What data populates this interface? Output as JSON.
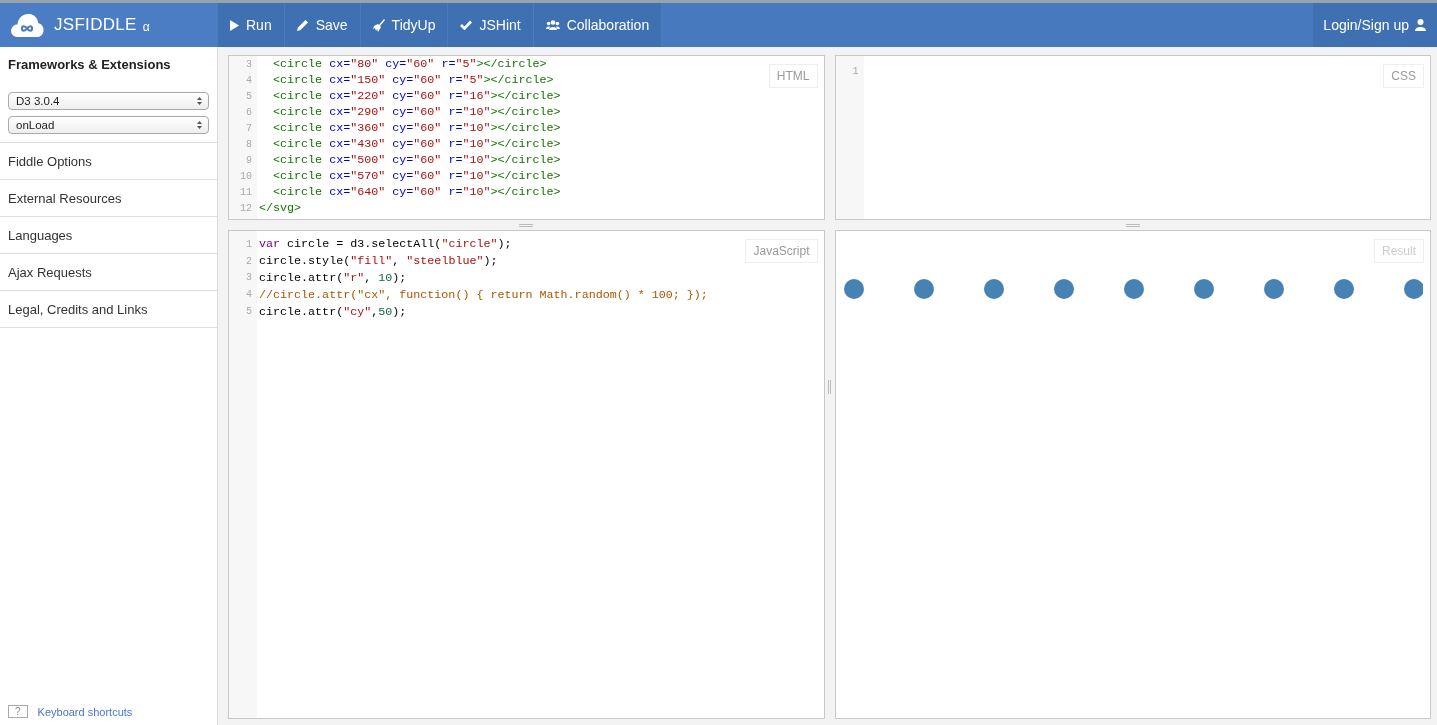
{
  "header": {
    "logo": "JSFIDDLE",
    "logo_suffix": "α",
    "actions": [
      {
        "label": "Run",
        "kind": "play"
      },
      {
        "label": "Save",
        "kind": "pencil"
      },
      {
        "label": "TidyUp",
        "kind": "broom"
      },
      {
        "label": "JSHint",
        "kind": "check"
      },
      {
        "label": "Collaboration",
        "kind": "people"
      }
    ],
    "login": "Login/Sign up"
  },
  "sidebar": {
    "heading": "Frameworks & Extensions",
    "selects": [
      {
        "value": "D3 3.0.4"
      },
      {
        "value": "onLoad"
      }
    ],
    "items": [
      "Fiddle Options",
      "External Resources",
      "Languages",
      "Ajax Requests",
      "Legal, Credits and Links"
    ],
    "shortcut_key": "?",
    "shortcut_link": "Keyboard shortcuts"
  },
  "html_panel": {
    "label": "HTML",
    "lines": [
      {
        "number": "3",
        "tokens": [
          {
            "t": "  <circle",
            "kind": "tag"
          },
          {
            "t": " cx=",
            "kind": "attr"
          },
          {
            "t": "\"80\"",
            "kind": "string"
          },
          {
            "t": " cy=",
            "kind": "attr"
          },
          {
            "t": "\"60\"",
            "kind": "string"
          },
          {
            "t": " r=",
            "kind": "attr"
          },
          {
            "t": "\"5\"",
            "kind": "string"
          },
          {
            "t": "></circle>",
            "kind": "tag"
          }
        ]
      },
      {
        "number": "4",
        "tokens": [
          {
            "t": "  <circle",
            "kind": "tag"
          },
          {
            "t": " cx=",
            "kind": "attr"
          },
          {
            "t": "\"150\"",
            "kind": "string"
          },
          {
            "t": " cy=",
            "kind": "attr"
          },
          {
            "t": "\"60\"",
            "kind": "string"
          },
          {
            "t": " r=",
            "kind": "attr"
          },
          {
            "t": "\"5\"",
            "kind": "string"
          },
          {
            "t": "></circle>",
            "kind": "tag"
          }
        ]
      },
      {
        "number": "5",
        "tokens": [
          {
            "t": "  <circle",
            "kind": "tag"
          },
          {
            "t": " cx=",
            "kind": "attr"
          },
          {
            "t": "\"220\"",
            "kind": "string"
          },
          {
            "t": " cy=",
            "kind": "attr"
          },
          {
            "t": "\"60\"",
            "kind": "string"
          },
          {
            "t": " r=",
            "kind": "attr"
          },
          {
            "t": "\"16\"",
            "kind": "string"
          },
          {
            "t": "></circle>",
            "kind": "tag"
          }
        ]
      },
      {
        "number": "6",
        "tokens": [
          {
            "t": "  <circle",
            "kind": "tag"
          },
          {
            "t": " cx=",
            "kind": "attr"
          },
          {
            "t": "\"290\"",
            "kind": "string"
          },
          {
            "t": " cy=",
            "kind": "attr"
          },
          {
            "t": "\"60\"",
            "kind": "string"
          },
          {
            "t": " r=",
            "kind": "attr"
          },
          {
            "t": "\"10\"",
            "kind": "string"
          },
          {
            "t": "></circle>",
            "kind": "tag"
          }
        ]
      },
      {
        "number": "7",
        "tokens": [
          {
            "t": "  <circle",
            "kind": "tag"
          },
          {
            "t": " cx=",
            "kind": "attr"
          },
          {
            "t": "\"360\"",
            "kind": "string"
          },
          {
            "t": " cy=",
            "kind": "attr"
          },
          {
            "t": "\"60\"",
            "kind": "string"
          },
          {
            "t": " r=",
            "kind": "attr"
          },
          {
            "t": "\"10\"",
            "kind": "string"
          },
          {
            "t": "></circle>",
            "kind": "tag"
          }
        ]
      },
      {
        "number": "8",
        "tokens": [
          {
            "t": "  <circle",
            "kind": "tag"
          },
          {
            "t": " cx=",
            "kind": "attr"
          },
          {
            "t": "\"430\"",
            "kind": "string"
          },
          {
            "t": " cy=",
            "kind": "attr"
          },
          {
            "t": "\"60\"",
            "kind": "string"
          },
          {
            "t": " r=",
            "kind": "attr"
          },
          {
            "t": "\"10\"",
            "kind": "string"
          },
          {
            "t": "></circle>",
            "kind": "tag"
          }
        ]
      },
      {
        "number": "9",
        "tokens": [
          {
            "t": "  <circle",
            "kind": "tag"
          },
          {
            "t": " cx=",
            "kind": "attr"
          },
          {
            "t": "\"500\"",
            "kind": "string"
          },
          {
            "t": " cy=",
            "kind": "attr"
          },
          {
            "t": "\"60\"",
            "kind": "string"
          },
          {
            "t": " r=",
            "kind": "attr"
          },
          {
            "t": "\"10\"",
            "kind": "string"
          },
          {
            "t": "></circle>",
            "kind": "tag"
          }
        ]
      },
      {
        "number": "10",
        "tokens": [
          {
            "t": "  <circle",
            "kind": "tag"
          },
          {
            "t": " cx=",
            "kind": "attr"
          },
          {
            "t": "\"570\"",
            "kind": "string"
          },
          {
            "t": " cy=",
            "kind": "attr"
          },
          {
            "t": "\"60\"",
            "kind": "string"
          },
          {
            "t": " r=",
            "kind": "attr"
          },
          {
            "t": "\"10\"",
            "kind": "string"
          },
          {
            "t": "></circle>",
            "kind": "tag"
          }
        ]
      },
      {
        "number": "11",
        "tokens": [
          {
            "t": "  <circle",
            "kind": "tag"
          },
          {
            "t": " cx=",
            "kind": "attr"
          },
          {
            "t": "\"640\"",
            "kind": "string"
          },
          {
            "t": " cy=",
            "kind": "attr"
          },
          {
            "t": "\"60\"",
            "kind": "string"
          },
          {
            "t": " r=",
            "kind": "attr"
          },
          {
            "t": "\"10\"",
            "kind": "string"
          },
          {
            "t": "></circle>",
            "kind": "tag"
          }
        ]
      },
      {
        "number": "12",
        "tokens": [
          {
            "t": "</svg>",
            "kind": "tag"
          }
        ]
      }
    ]
  },
  "css_panel": {
    "label": "CSS",
    "lines": [
      {
        "number": "1"
      }
    ]
  },
  "js_panel": {
    "label": "JavaScript",
    "lines": [
      {
        "number": "1",
        "tokens": [
          {
            "t": "var",
            "kind": "keyword"
          },
          {
            "t": " circle = d3.selectAll(",
            "kind": "plain"
          },
          {
            "t": "\"circle\"",
            "kind": "string"
          },
          {
            "t": ");",
            "kind": "plain"
          }
        ]
      },
      {
        "number": "2",
        "tokens": [
          {
            "t": "circle.style(",
            "kind": "plain"
          },
          {
            "t": "\"fill\"",
            "kind": "string"
          },
          {
            "t": ", ",
            "kind": "plain"
          },
          {
            "t": "\"steelblue\"",
            "kind": "string"
          },
          {
            "t": ");",
            "kind": "plain"
          }
        ]
      },
      {
        "number": "3",
        "tokens": [
          {
            "t": "circle.attr(",
            "kind": "plain"
          },
          {
            "t": "\"r\"",
            "kind": "string"
          },
          {
            "t": ", ",
            "kind": "plain"
          },
          {
            "t": "10",
            "kind": "number"
          },
          {
            "t": ");",
            "kind": "plain"
          }
        ]
      },
      {
        "number": "4",
        "tokens": [
          {
            "t": "//circle.attr(\"cx\", function() { return Math.random() * 100; });",
            "kind": "comment"
          }
        ]
      },
      {
        "number": "5",
        "tokens": [
          {
            "t": "circle.attr(",
            "kind": "plain"
          },
          {
            "t": "\"cy\"",
            "kind": "string"
          },
          {
            "t": ",",
            "kind": "plain"
          },
          {
            "t": "50",
            "kind": "number"
          },
          {
            "t": ");",
            "kind": "plain"
          }
        ]
      }
    ]
  },
  "result_panel": {
    "label": "Result"
  }
}
